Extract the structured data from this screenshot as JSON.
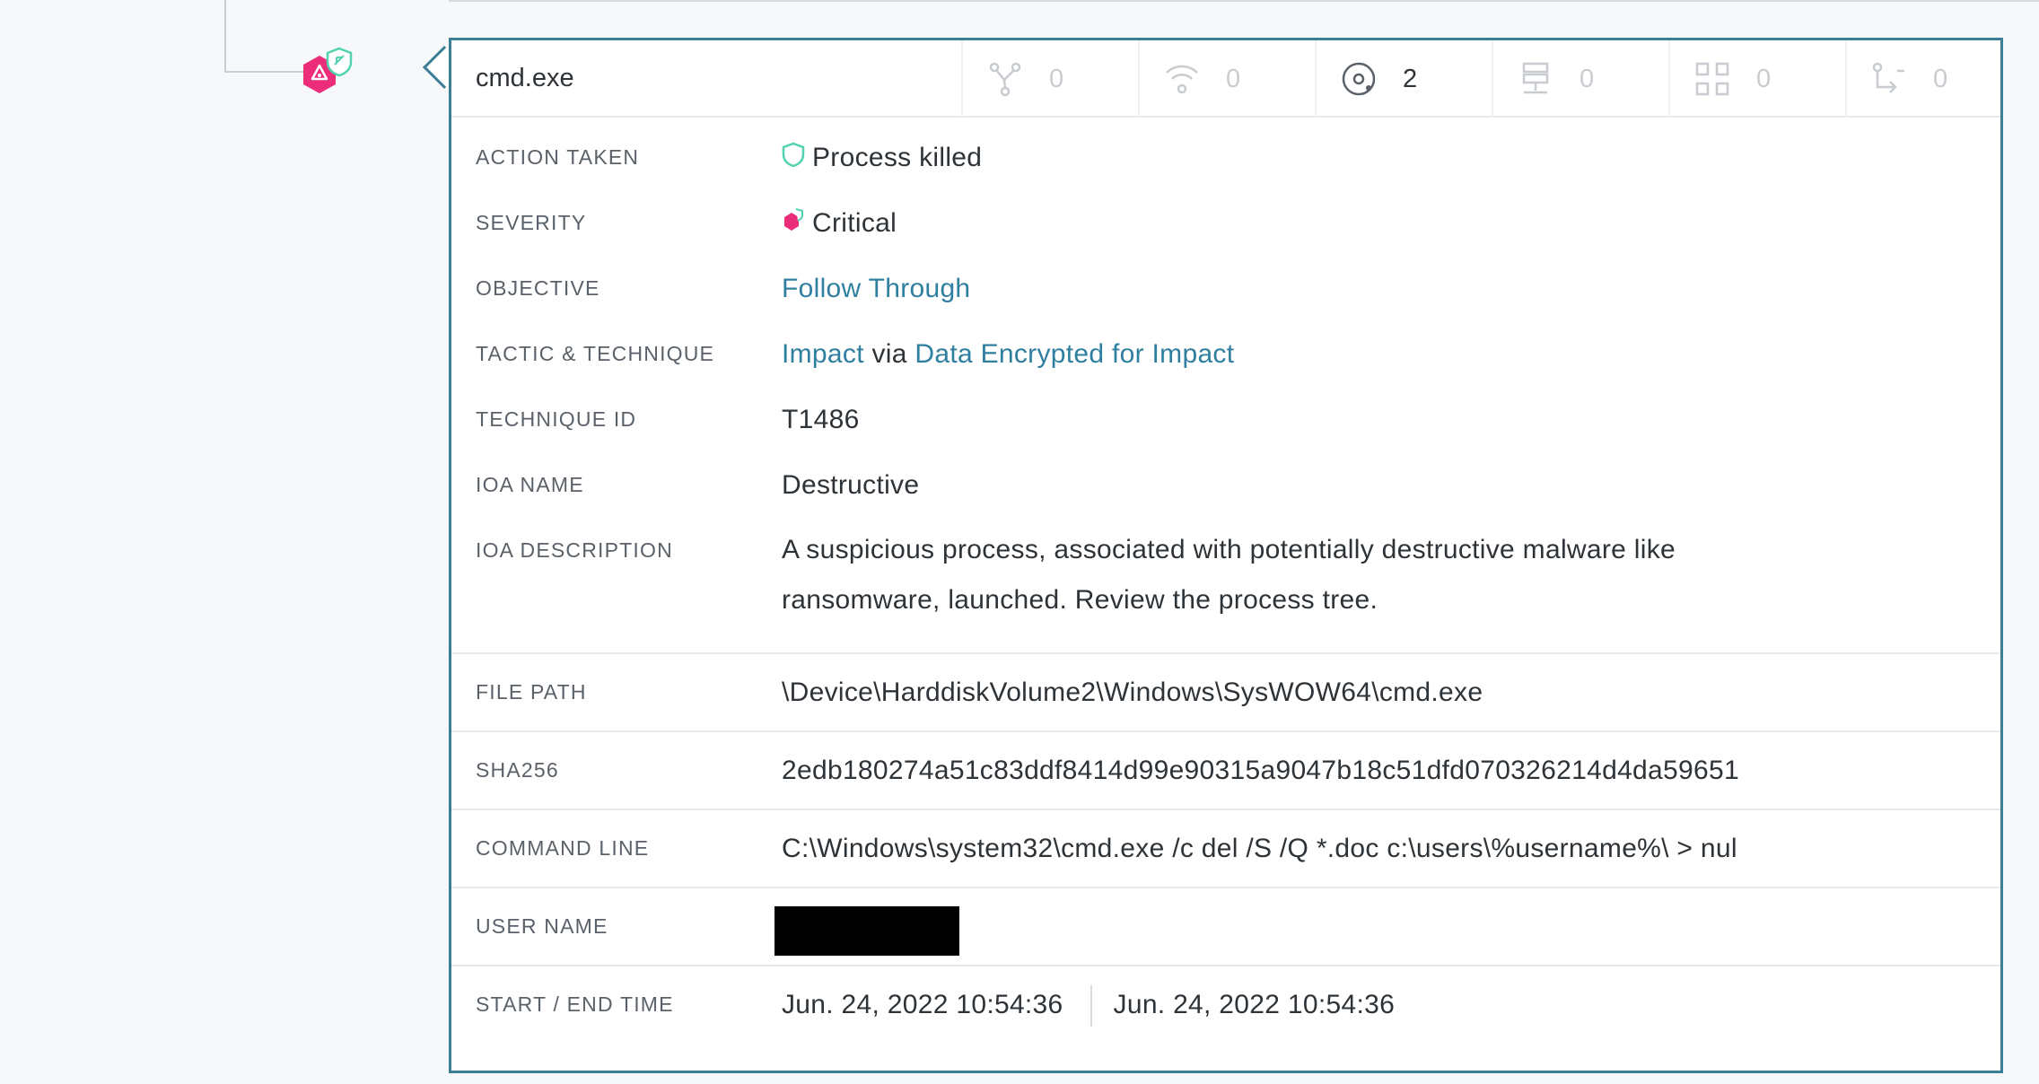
{
  "colors": {
    "accent": "#3a7f95",
    "link": "#2f7fa0",
    "critical": "#ec2d7a",
    "shield": "#53d2b0"
  },
  "node": {
    "icon": "critical-process-node-icon",
    "badge_icon": "shield-badge-icon"
  },
  "header": {
    "process_name": "cmd.exe",
    "stats": [
      {
        "icon": "process-tree-icon",
        "count": "0"
      },
      {
        "icon": "network-icon",
        "count": "0"
      },
      {
        "icon": "disk-icon",
        "count": "2"
      },
      {
        "icon": "dns-server-icon",
        "count": "0"
      },
      {
        "icon": "modules-icon",
        "count": "0"
      },
      {
        "icon": "registry-icon",
        "count": "0"
      }
    ]
  },
  "details": {
    "action_taken": {
      "label": "ACTION TAKEN",
      "value": "Process killed",
      "icon": "shield-icon"
    },
    "severity": {
      "label": "SEVERITY",
      "value": "Critical",
      "icon": "critical-hexagon-icon"
    },
    "objective": {
      "label": "OBJECTIVE",
      "value": "Follow Through"
    },
    "tactic": {
      "label": "TACTIC & TECHNIQUE",
      "tactic": "Impact",
      "via": "via",
      "technique": "Data Encrypted for Impact"
    },
    "technique_id": {
      "label": "TECHNIQUE ID",
      "value": "T1486"
    },
    "ioa_name": {
      "label": "IOA NAME",
      "value": "Destructive"
    },
    "ioa_description": {
      "label": "IOA DESCRIPTION",
      "value": "A suspicious process, associated with potentially destructive malware like ransomware, launched. Review the process tree."
    },
    "file_path": {
      "label": "FILE PATH",
      "value": "\\Device\\HarddiskVolume2\\Windows\\SysWOW64\\cmd.exe"
    },
    "sha256": {
      "label": "SHA256",
      "value": "2edb180274a51c83ddf8414d99e90315a9047b18c51dfd070326214d4da59651"
    },
    "command_line": {
      "label": "COMMAND LINE",
      "value": "C:\\Windows\\system32\\cmd.exe /c del /S /Q *.doc c:\\users\\%username%\\ > nul"
    },
    "user_name": {
      "label": "USER NAME"
    },
    "time": {
      "label": "START / END TIME",
      "start": "Jun. 24, 2022 10:54:36",
      "end": "Jun. 24, 2022 10:54:36"
    }
  }
}
